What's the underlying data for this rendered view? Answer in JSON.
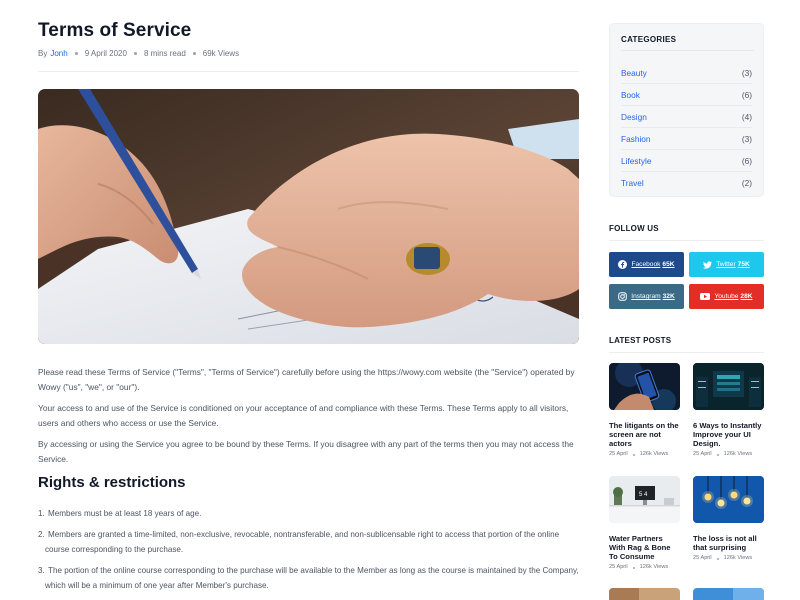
{
  "article": {
    "title": "Terms of Service",
    "meta": {
      "by_prefix": "By",
      "author": "Jonh",
      "date": "9 April 2020",
      "read_time": "8 mins read",
      "views": "69k Views"
    },
    "hero_image": "hand-signing-document",
    "paragraphs": [
      "Please read these Terms of Service (\"Terms\", \"Terms of Service\") carefully before using the https://wowy.com website (the \"Service\") operated by Wowy (\"us\", \"we\", or \"our\").",
      "Your access to and use of the Service is conditioned on your acceptance of and compliance with these Terms. These Terms apply to all visitors, users and others who access or use the Service.",
      "By accessing or using the Service you agree to be bound by these Terms. If you disagree with any part of the terms then you may not access the Service."
    ],
    "section_heading": "Rights & restrictions",
    "rights_list": [
      {
        "num": "1.",
        "text": "Members must be at least 18 years of age."
      },
      {
        "num": "2.",
        "text": "Members are granted a time-limited, non-exclusive, revocable, nontransferable, and non-sublicensable right to access that portion of the online course corresponding to the purchase."
      },
      {
        "num": "3.",
        "text": "The portion of the online course corresponding to the purchase will be available to the Member as long as the course is maintained by the Company, which will be a minimum of one year after Member's purchase."
      }
    ]
  },
  "sidebar": {
    "categories": {
      "heading": "CATEGORIES",
      "items": [
        {
          "name": "Beauty",
          "count": "(3)"
        },
        {
          "name": "Book",
          "count": "(6)"
        },
        {
          "name": "Design",
          "count": "(4)"
        },
        {
          "name": "Fashion",
          "count": "(3)"
        },
        {
          "name": "Lifestyle",
          "count": "(6)"
        },
        {
          "name": "Travel",
          "count": "(2)"
        }
      ]
    },
    "follow": {
      "heading": "FOLLOW US",
      "networks": [
        {
          "name": "Facebook",
          "count": "65K",
          "icon": "facebook-icon",
          "color": "#1e4a8b"
        },
        {
          "name": "Twitter",
          "count": "75K",
          "icon": "twitter-icon",
          "color": "#1ec8ec"
        },
        {
          "name": "Instagram",
          "count": "32K",
          "icon": "instagram-icon",
          "color": "#3b6a86"
        },
        {
          "name": "Youtube",
          "count": "28K",
          "icon": "youtube-icon",
          "color": "#e52d27"
        }
      ]
    },
    "latest": {
      "heading": "LATEST POSTS",
      "posts": [
        {
          "title": "The litigants on the screen are not actors",
          "date": "25 April",
          "views": "126k Views",
          "image": "hand-holding-phone"
        },
        {
          "title": "6 Ways to Instantly Improve your UI Design.",
          "date": "25 April",
          "views": "126k Views",
          "image": "server-room"
        },
        {
          "title": "Water Partners With Rag & Bone To Consume",
          "date": "25 April",
          "views": "126k Views",
          "image": "desk-monitor"
        },
        {
          "title": "The loss is not all that surprising",
          "date": "25 April",
          "views": "126k Views",
          "image": "light-bulbs"
        },
        {
          "title": "",
          "date": "",
          "views": "",
          "image": "post-thumbnail"
        },
        {
          "title": "",
          "date": "",
          "views": "",
          "image": "post-thumbnail"
        }
      ]
    }
  },
  "colors": {
    "link": "#2563eb",
    "heading": "#111827",
    "body_text": "#4b5563",
    "card_bg": "#f5f6f8"
  }
}
